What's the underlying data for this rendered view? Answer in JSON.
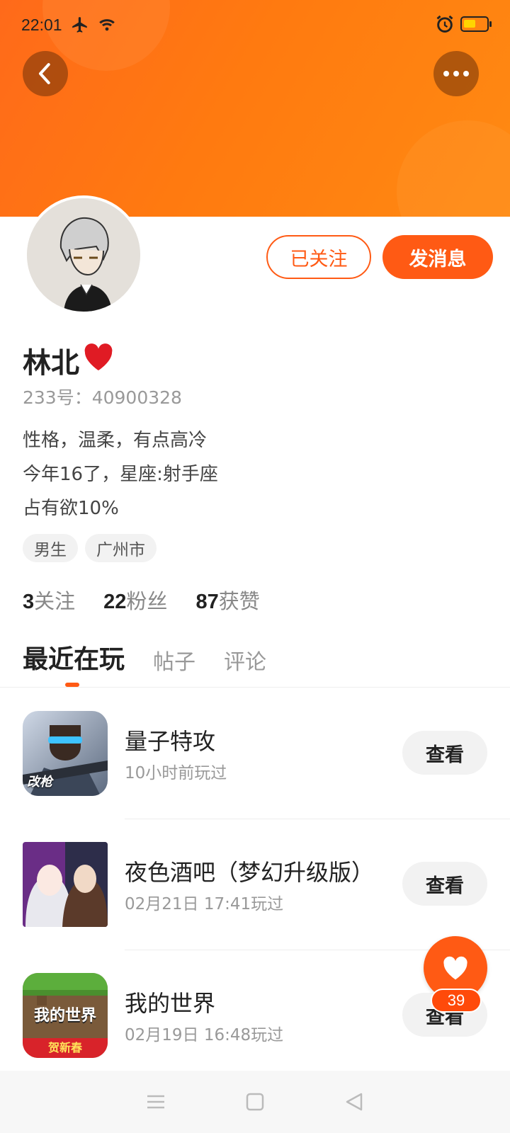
{
  "status_bar": {
    "time": "22:01"
  },
  "header": {
    "back_icon": "chevron-left-icon",
    "more_icon": "more-dots-icon"
  },
  "profile": {
    "follow_label": "已关注",
    "message_label": "发消息",
    "name": "林北",
    "name_emoji": "❤️",
    "id_text": "233号：40900328",
    "bio_lines": [
      "性格，温柔，有点高冷",
      "今年16了，星座:射手座",
      "占有欲10%"
    ],
    "tags": [
      "男生",
      "广州市"
    ],
    "stats": [
      {
        "num": "3",
        "label": "关注"
      },
      {
        "num": "22",
        "label": "粉丝"
      },
      {
        "num": "87",
        "label": "获赞"
      }
    ]
  },
  "tabs": [
    "最近在玩",
    "帖子",
    "评论"
  ],
  "games": [
    {
      "name": "量子特攻",
      "time": "10小时前玩过",
      "action": "查看",
      "icon_text": "改枪"
    },
    {
      "name": "夜色酒吧（梦幻升级版）",
      "time": "02月21日 17:41玩过",
      "action": "查看"
    },
    {
      "name": "我的世界",
      "time": "02月19日 16:48玩过",
      "action": "查看",
      "icon_text": "我的世界",
      "icon_subtext": "贺新春"
    }
  ],
  "fab": {
    "count": "39"
  },
  "colors": {
    "accent": "#ff5a14",
    "banner": "#ff7a10"
  }
}
